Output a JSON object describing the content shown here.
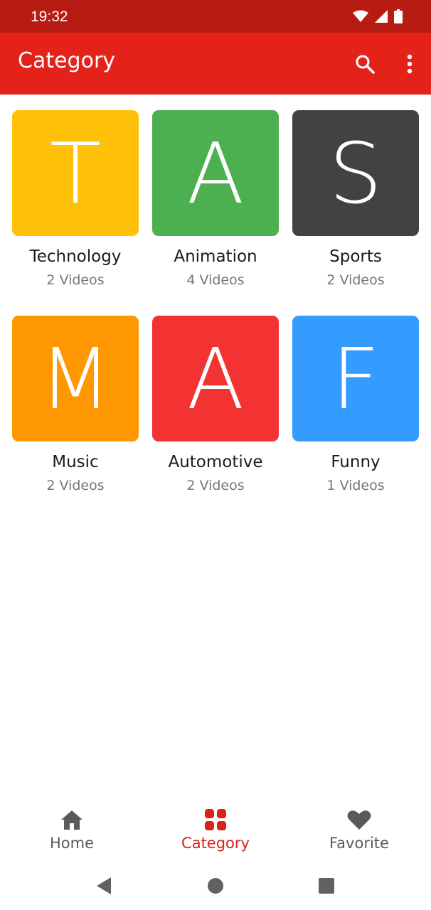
{
  "status_bar": {
    "time": "19:32"
  },
  "app_bar": {
    "title": "Category"
  },
  "colors": {
    "status_bar": "#b71c13",
    "app_bar": "#e5221a",
    "accent": "#d8221a",
    "inactive": "#5a5a5a"
  },
  "categories": [
    {
      "letter": "T",
      "name": "Technology",
      "count": "2 Videos",
      "color": "#ffc107"
    },
    {
      "letter": "A",
      "name": "Animation",
      "count": "4 Videos",
      "color": "#4caf50"
    },
    {
      "letter": "S",
      "name": "Sports",
      "count": "2 Videos",
      "color": "#424242"
    },
    {
      "letter": "M",
      "name": "Music",
      "count": "2 Videos",
      "color": "#ff9800"
    },
    {
      "letter": "A",
      "name": "Automotive",
      "count": "2 Videos",
      "color": "#f33232"
    },
    {
      "letter": "F",
      "name": "Funny",
      "count": "1 Videos",
      "color": "#349bff"
    }
  ],
  "bottom_nav": {
    "items": [
      {
        "label": "Home",
        "icon": "home-icon",
        "active": false
      },
      {
        "label": "Category",
        "icon": "grid-icon",
        "active": true
      },
      {
        "label": "Favorite",
        "icon": "heart-icon",
        "active": false
      }
    ]
  },
  "icons": {
    "search": "search-icon",
    "more": "more-vert-icon",
    "back": "back-triangle-icon",
    "home": "home-circle-icon",
    "recents": "recents-square-icon"
  }
}
